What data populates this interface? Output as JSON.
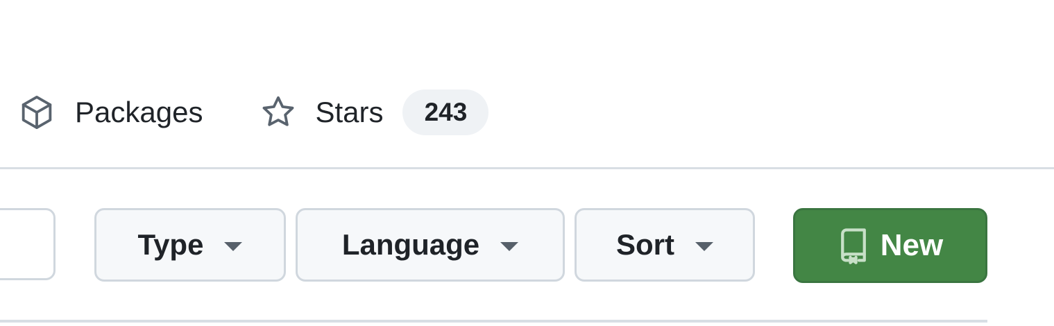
{
  "tabs": {
    "packages": {
      "label": "Packages",
      "icon": "package-icon"
    },
    "stars": {
      "label": "Stars",
      "icon": "star-icon",
      "count": "243"
    }
  },
  "filters": {
    "type_label": "Type",
    "language_label": "Language",
    "sort_label": "Sort"
  },
  "new_button": {
    "label": "New",
    "icon": "repo-icon"
  },
  "colors": {
    "new_button_bg": "#438645",
    "filter_bg": "#f6f8fa",
    "counter_bg": "#eff2f5",
    "border": "#d0d7de",
    "text": "#1f2328"
  }
}
